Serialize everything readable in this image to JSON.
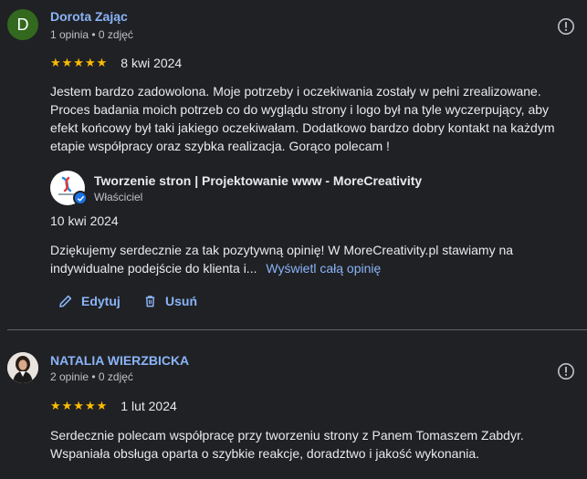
{
  "colors": {
    "background": "#202124",
    "link": "#8ab4f8",
    "star": "#fbbc04",
    "avatar_letter_bg": "#33691e"
  },
  "reviews": [
    {
      "avatar_letter": "D",
      "name": "Dorota Zając",
      "meta": "1 opinia • 0 zdjęć",
      "stars": "★★★★★",
      "rating": 5,
      "date": "8 kwi 2024",
      "text": "Jestem bardzo zadowolona. Moje potrzeby i oczekiwania zostały w pełni zrealizowane. Proces badania moich potrzeb co do wyglądu strony i logo był na tyle wyczerpujący, aby efekt końcowy był taki jakiego oczekiwałam. Dodatkowo bardzo dobry kontakt na każdym etapie współpracy oraz szybka realizacja. Gorąco polecam !",
      "owner_reply": {
        "name": "Tworzenie stron | Projektowanie www - MoreCreativity",
        "role": "Właściciel",
        "date": "10 kwi 2024",
        "text": "Dziękujemy serdecznie za tak pozytywną opinię! W MoreCreativity.pl stawiamy na indywidualne podejście do klienta i...",
        "more_link": "Wyświetl całą opinię"
      },
      "actions": {
        "edit": "Edytuj",
        "delete": "Usuń"
      }
    },
    {
      "name": "NATALIA WIERZBICKA",
      "meta": "2 opinie • 0 zdjęć",
      "stars": "★★★★★",
      "rating": 5,
      "date": "1 lut 2024",
      "text": "Serdecznie polecam współpracę przy tworzeniu strony z Panem Tomaszem Zabdyr. Wspaniała obsługa oparta o szybkie reakcje, doradztwo i jakość wykonania."
    }
  ]
}
